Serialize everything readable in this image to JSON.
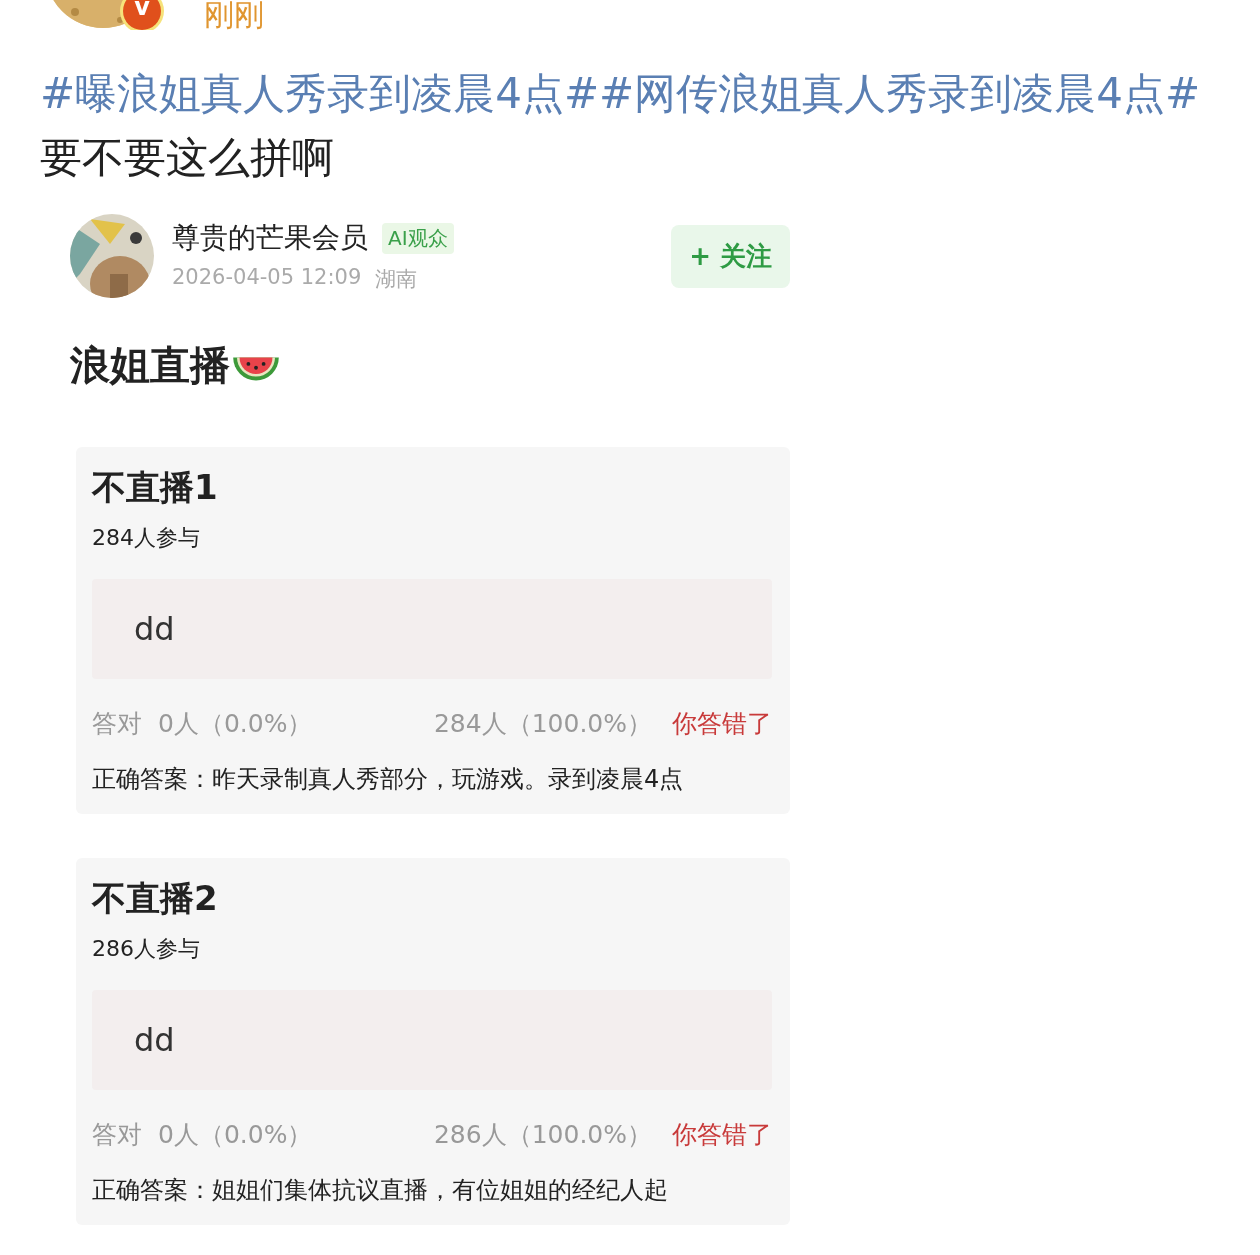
{
  "author": {
    "badge": "v",
    "time": "刚刚"
  },
  "post": {
    "segments": [
      {
        "kind": "hashtag",
        "text": "#曝浪姐真人秀录到凌晨4点#"
      },
      {
        "kind": "hashtag",
        "text": "#网传浪姐真人秀录到凌晨4点#"
      },
      {
        "kind": "text",
        "text": " 要不要这么拼啊"
      }
    ]
  },
  "embed": {
    "user": {
      "name": "尊贵的芒果会员",
      "tag": "AI观众",
      "time": "2026-04-05 12:09",
      "location": "湖南"
    },
    "follow_button": "+ 关注",
    "title": "浪姐直播",
    "polls": [
      {
        "title": "不直播1",
        "participants": "284人参与",
        "option": "dd",
        "correct_label": "答对",
        "correct_count": "0人（0.0%）",
        "wrong_count": "284人（100.0%）",
        "result": "你答错了",
        "answer": "正确答案：昨天录制真人秀部分，玩游戏。录到凌晨4点"
      },
      {
        "title": "不直播2",
        "participants": "286人参与",
        "option": "dd",
        "correct_label": "答对",
        "correct_count": "0人（0.0%）",
        "wrong_count": "286人（100.0%）",
        "result": "你答错了",
        "answer": "正确答案：姐姐们集体抗议直播，有位姐姐的经纪人起"
      }
    ]
  }
}
